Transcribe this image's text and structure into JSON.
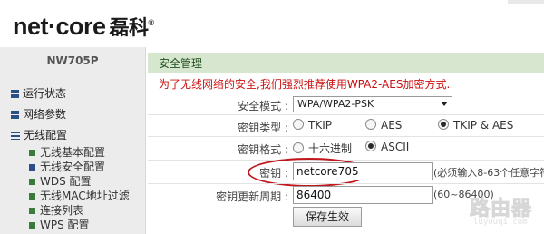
{
  "header": {
    "logo_text": "net·core",
    "logo_cn": "磊科",
    "logo_reg": "®"
  },
  "sidebar": {
    "model": "NW705P",
    "groups": [
      {
        "label": "运行状态"
      },
      {
        "label": "网络参数"
      },
      {
        "label": "无线配置"
      }
    ],
    "wireless_items": [
      {
        "label": "无线基本配置"
      },
      {
        "label": "无线安全配置",
        "active": true
      },
      {
        "label": "WDS 配置"
      },
      {
        "label": "无线MAC地址过滤"
      },
      {
        "label": "连接列表"
      },
      {
        "label": "WPS 配置"
      }
    ]
  },
  "main": {
    "section_title": "安全管理",
    "notice": "为了无线网络的安全,我们强烈推荐使用WPA2-AES加密方式.",
    "security_mode": {
      "label": "安全模式 :",
      "value": "WPA/WPA2-PSK"
    },
    "key_type": {
      "label": "密钥类型 :",
      "options": [
        {
          "label": "TKIP",
          "selected": false
        },
        {
          "label": "AES",
          "selected": false
        },
        {
          "label": "TKIP & AES",
          "selected": true
        }
      ]
    },
    "key_format": {
      "label": "密钥格式 :",
      "options": [
        {
          "label": "十六进制",
          "selected": false
        },
        {
          "label": "ASCII",
          "selected": true
        }
      ]
    },
    "key": {
      "label": "密钥 :",
      "value": "netcore705",
      "hint": "(必须输入8-63个任意字符"
    },
    "key_update": {
      "label": "密钥更新周期 :",
      "value": "86400",
      "hint": "(60~86400)"
    },
    "save_button": "保存生效"
  },
  "watermark": {
    "text": "路由器",
    "sub": "luyouqi.com"
  },
  "colors": {
    "title_bar": "#d7e6cf",
    "notice": "#cc1010",
    "highlight_oval": "#c0161c",
    "sidebar_bg": "#ececec"
  }
}
